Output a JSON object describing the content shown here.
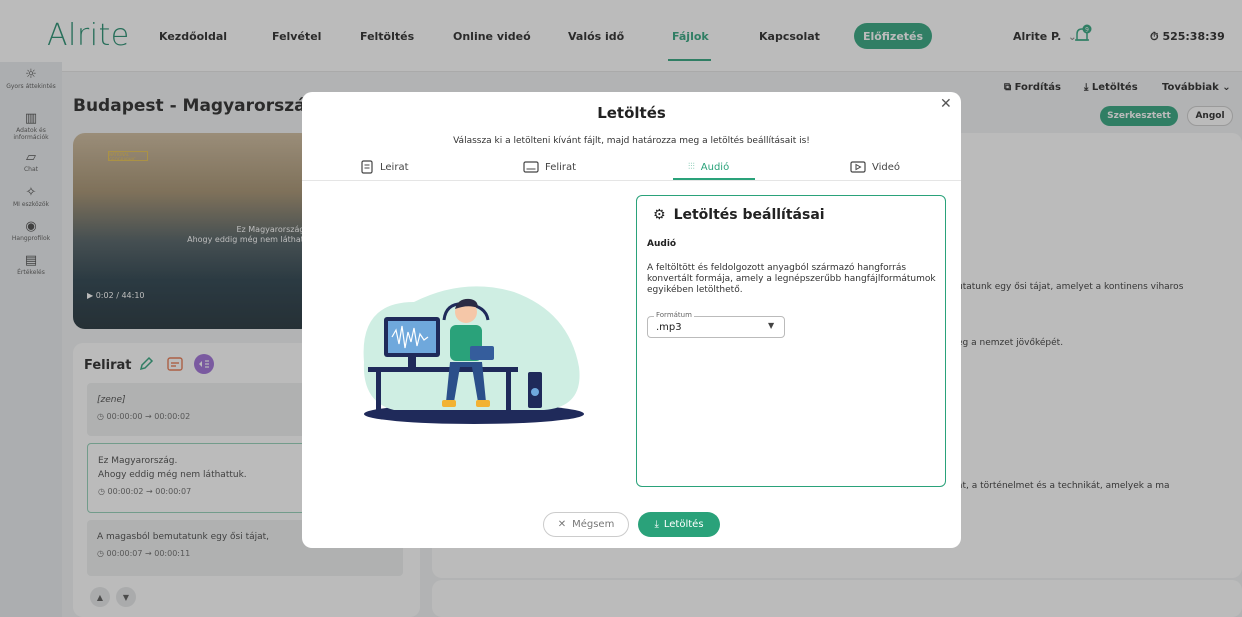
{
  "app": {
    "logo": "Alrite"
  },
  "nav": {
    "items": [
      "Kezdőoldal",
      "Felvétel",
      "Feltöltés",
      "Online videó",
      "Valós idő",
      "Fájlok",
      "Kapcsolat"
    ],
    "active": "Fájlok",
    "subscribe": "Előfizetés",
    "user": "Alrite P.",
    "user_chevron": "⌄",
    "notification_count": "9",
    "timer": "525:38:39"
  },
  "sidebar": {
    "items": [
      "Gyors áttekintés",
      "Adatok és információk",
      "Chat",
      "MI eszközök",
      "Hangprofilok",
      "Értékelés"
    ]
  },
  "page": {
    "title": "Budapest - Magyarország",
    "video_brand": "NATIONAL GEOGRAPHIC",
    "video_caption_1": "Ez Magyarország.",
    "video_caption_2": "Ahogy eddig még nem láthatt",
    "video_time": "0:02 / 44:10"
  },
  "transcript": {
    "title": "Felirat",
    "segments": [
      {
        "text": "[zene]",
        "time": "00:00:00 → 00:00:02"
      },
      {
        "text_1": "Ez Magyarország.",
        "text_2": "Ahogy eddig még nem láthattuk.",
        "time": "00:00:02 → 00:00:07"
      },
      {
        "text": "A magasból bemutatunk egy ősi tájat,",
        "time": "00:00:07 → 00:00:11"
      }
    ]
  },
  "right": {
    "translate": "Fordítás",
    "download": "Letöltés",
    "more": "Továbbiak",
    "edited": "Szerkesztett",
    "language": "Angol",
    "text_1": "utatunk egy ősi tájat, amelyet a kontinens viharos",
    "text_2": "eg a nemzet jövőképét.",
    "text_3": "át, a történelmet és a technikát, amelyek a ma"
  },
  "modal": {
    "title": "Letöltés",
    "subtitle": "Válassza ki a letölteni kívánt fájlt, majd határozza meg a letöltés beállításait is!",
    "tabs": [
      "Leirat",
      "Felirat",
      "Audió",
      "Videó"
    ],
    "active_tab": "Audió",
    "settings_title": "Letöltés beállításai",
    "settings_subtitle": "Audió",
    "settings_desc": "A feltöltött és feldolgozott anyagból származó hangforrás konvertált formája, amely a legnépszerűbb hangfájlformátumok egyikében letölthető.",
    "format_label": "Formátum",
    "format_value": ".mp3",
    "cancel": "Mégsem",
    "download": "Letöltés"
  },
  "colors": {
    "accent": "#2aa27a",
    "purple": "#9b6bd6"
  }
}
